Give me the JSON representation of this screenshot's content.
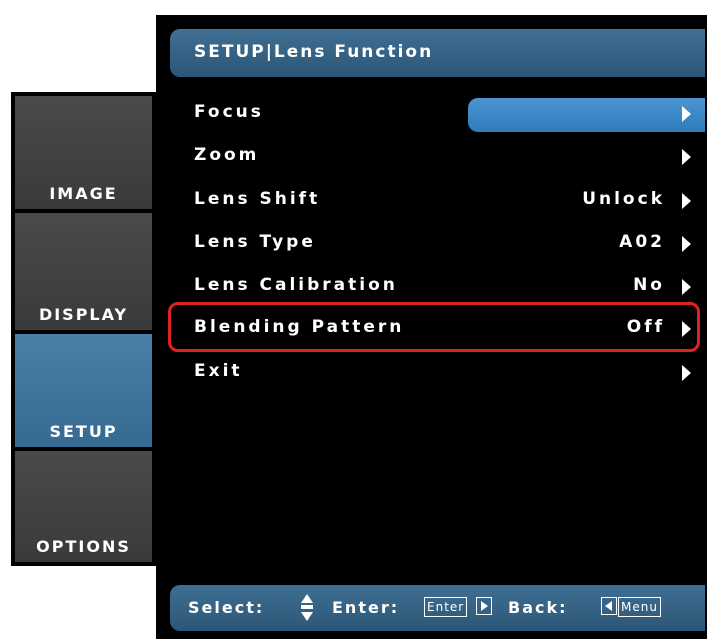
{
  "tabs": [
    {
      "label": "IMAGE",
      "active": false
    },
    {
      "label": "DISPLAY",
      "active": false
    },
    {
      "label": "SETUP",
      "active": true
    },
    {
      "label": "OPTIONS",
      "active": false
    }
  ],
  "header": {
    "title": "SETUP|Lens Function"
  },
  "menu": [
    {
      "label": "Focus",
      "value": "",
      "selected": true
    },
    {
      "label": "Zoom",
      "value": ""
    },
    {
      "label": "Lens Shift",
      "value": "Unlock"
    },
    {
      "label": "Lens Type",
      "value": "A02"
    },
    {
      "label": "Lens Calibration",
      "value": "No"
    },
    {
      "label": "Blending Pattern",
      "value": "Off",
      "highlighted_box": true
    },
    {
      "label": "Exit",
      "value": ""
    }
  ],
  "footer": {
    "select_label": "Select:",
    "enter_label": "Enter:",
    "enter_key": "Enter",
    "back_label": "Back:",
    "menu_key": "Menu"
  },
  "colors": {
    "accent_blue": "#3f6f93",
    "selected_blue": "#3a88c8",
    "highlight_red": "#e32020"
  },
  "icons": {
    "row_arrow": "arrow-right-icon",
    "select": "up-down-icon"
  }
}
